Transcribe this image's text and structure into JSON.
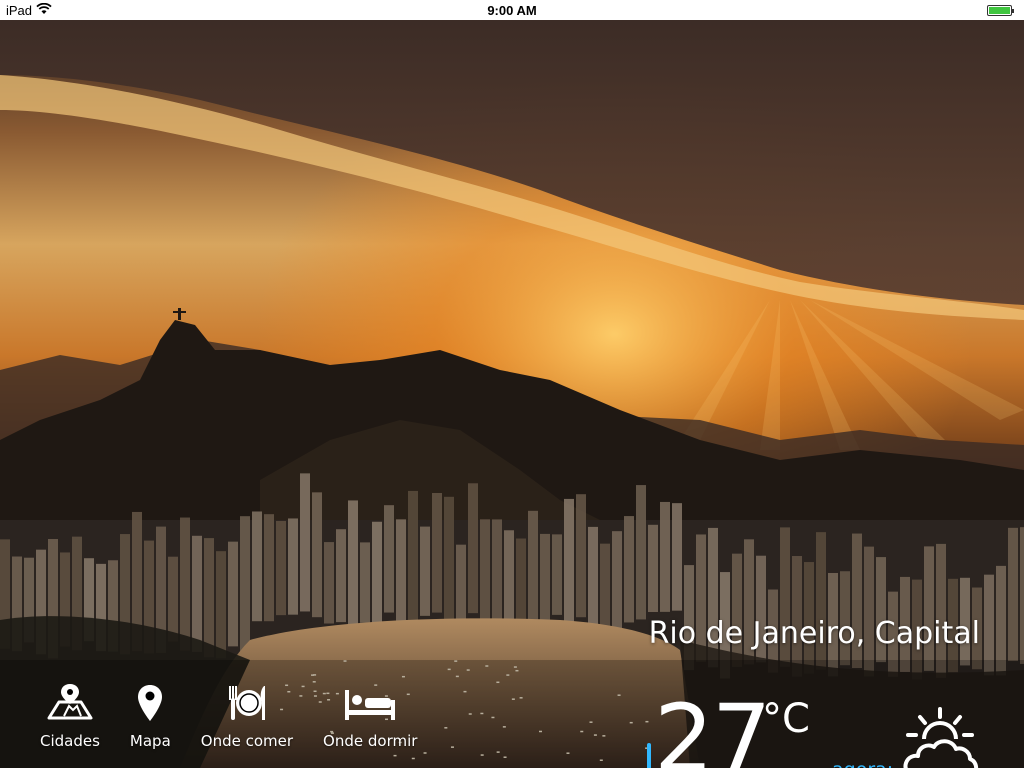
{
  "status_bar": {
    "device": "iPad",
    "time": "9:00 AM",
    "battery_level": 1.0
  },
  "nav": {
    "items": [
      {
        "label": "Cidades",
        "icon": "map-area-icon"
      },
      {
        "label": "Mapa",
        "icon": "map-pin-icon"
      },
      {
        "label": "Onde comer",
        "icon": "plate-cutlery-icon"
      },
      {
        "label": "Onde dormir",
        "icon": "bed-icon"
      }
    ]
  },
  "weather": {
    "city": "Rio de Janeiro, Capital",
    "temperature": "27",
    "unit": "°C",
    "now_label": "agora:",
    "condition_icon": "partly-cloudy-icon"
  },
  "colors": {
    "accent": "#31b8ff",
    "battery": "#3fc53f"
  }
}
